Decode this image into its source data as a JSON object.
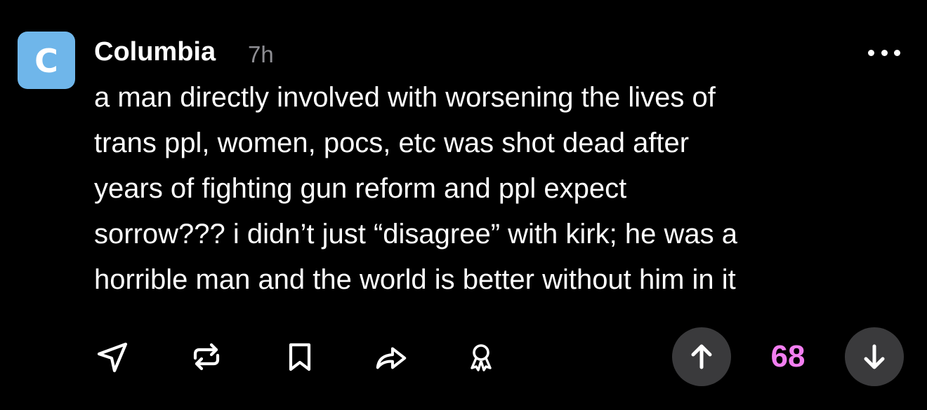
{
  "post": {
    "author": "Columbia",
    "avatar_letter": "C",
    "time": "7h",
    "lines": [
      "a man directly involved with worsening the lives of",
      "trans ppl, women, pocs, etc was shot dead after",
      "years of fighting gun reform and ppl expect",
      "sorrow???  i didn’t just “disagree” with kirk; he was a",
      "horrible man and the world is better without him in it"
    ],
    "score": "68"
  },
  "colors": {
    "background": "#000000",
    "avatar": "#6fb6ea",
    "score": "#f27ef0",
    "vote_button": "#3a3a3c",
    "muted_text": "#8e8e93"
  },
  "icons": {
    "more": "more-dots-icon",
    "reply": "paper-plane-icon",
    "repost": "repost-icon",
    "bookmark": "bookmark-icon",
    "share": "share-arrow-icon",
    "award": "award-ribbon-icon",
    "upvote": "arrow-up-icon",
    "downvote": "arrow-down-icon"
  }
}
